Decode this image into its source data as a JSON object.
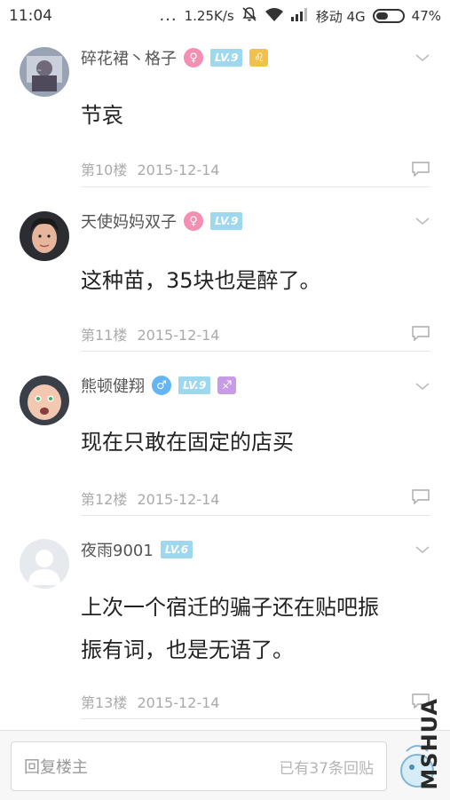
{
  "status_bar": {
    "time": "11:04",
    "dots": "...",
    "speed": "1.25K/s",
    "carrier": "移动 4G",
    "battery": "47%",
    "battery_level": 0.47
  },
  "posts": [
    {
      "username": "碎花裙丶格子",
      "gender": "female",
      "gender_symbol": "♀",
      "level": "LV.9",
      "zodiac_symbol": "♌",
      "content": "节哀",
      "floor": "第10楼",
      "date": "2015-12-14"
    },
    {
      "username": "天使妈妈双子",
      "gender": "female",
      "gender_symbol": "♀",
      "level": "LV.9",
      "content": "这种苗，35块也是醉了。",
      "floor": "第11楼",
      "date": "2015-12-14"
    },
    {
      "username": "熊顿健翔",
      "gender": "male",
      "gender_symbol": "♂",
      "level": "LV.9",
      "zodiac_symbol": "♐",
      "content": "现在只敢在固定的店买",
      "floor": "第12楼",
      "date": "2015-12-14"
    },
    {
      "username": "夜雨9001",
      "level": "LV.6",
      "content_line1": "上次一个宿迁的骗子还在贴吧振",
      "content_line2": "振有词，也是无语了。",
      "floor": "第13楼",
      "date": "2015-12-14"
    }
  ],
  "reply_bar": {
    "placeholder": "回复楼主",
    "count_text": "已有37条回贴"
  },
  "watermark": {
    "text": "MSHUA"
  },
  "icons": {
    "chevron": "chevron-down-icon",
    "comment": "comment-icon",
    "mute": "bell-mute-icon",
    "wifi": "wifi-icon",
    "signal": "signal-icon",
    "battery": "battery-icon"
  }
}
